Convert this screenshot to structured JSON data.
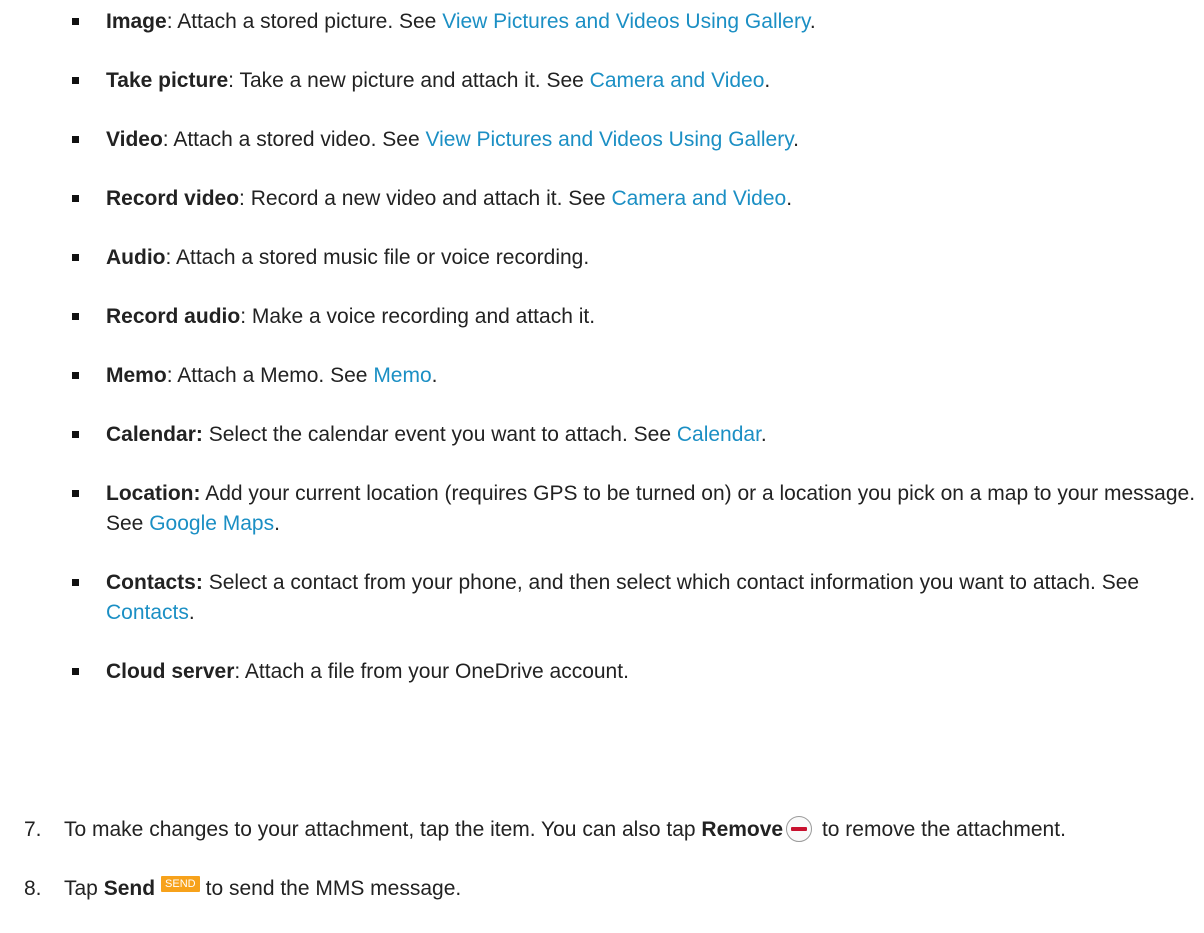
{
  "attachment_options": [
    {
      "term": "Image",
      "sep": ": ",
      "desc": "Attach a stored picture. See ",
      "link": "View Pictures and Videos Using Gallery",
      "tail": "."
    },
    {
      "term": "Take picture",
      "sep": ": ",
      "desc": "Take a new picture and attach it. See ",
      "link": "Camera and Video",
      "tail": "."
    },
    {
      "term": "Video",
      "sep": ": ",
      "desc": "Attach a stored video. See ",
      "link": "View Pictures and Videos Using Gallery",
      "tail": "."
    },
    {
      "term": "Record video",
      "sep": ": ",
      "desc": "Record a new video and attach it. See ",
      "link": "Camera and Video",
      "tail": "."
    },
    {
      "term": "Audio",
      "sep": ": ",
      "desc": "Attach a stored music file or voice recording.",
      "link": "",
      "tail": ""
    },
    {
      "term": "Record audio",
      "sep": ": ",
      "desc": "Make a voice recording and attach it.",
      "link": "",
      "tail": ""
    },
    {
      "term": "Memo",
      "sep": ": ",
      "desc": "Attach a Memo. See ",
      "link": "Memo",
      "tail": "."
    },
    {
      "term": "Calendar:",
      "sep": " ",
      "desc": "Select the calendar event you want to attach. See ",
      "link": "Calendar",
      "tail": "."
    },
    {
      "term": "Location:",
      "sep": " ",
      "desc": "Add your current location (requires GPS to be turned on) or a location you pick on a map to your message. See ",
      "link": "Google Maps",
      "tail": "."
    },
    {
      "term": "Contacts:",
      "sep": " ",
      "desc": "Select a contact from your phone, and then select which contact information you want to attach. See ",
      "link": "Contacts",
      "tail": "."
    },
    {
      "term": "Cloud server",
      "sep": ": ",
      "desc": "Attach a file from your OneDrive account.",
      "link": "",
      "tail": ""
    }
  ],
  "steps": {
    "step7": {
      "number": "7.",
      "before": "To make changes to your attachment, tap the item. You can also tap ",
      "bold": "Remove",
      "icon": "remove-icon",
      "after": " to remove the attachment."
    },
    "step8": {
      "number": "8.",
      "before": "Tap ",
      "bold": "Send",
      "icon_label": "SEND",
      "after": "to send the MMS message."
    }
  },
  "colors": {
    "link": "#1b8fc4",
    "send_button": "#f7a21b",
    "remove_dash": "#c8102e"
  }
}
